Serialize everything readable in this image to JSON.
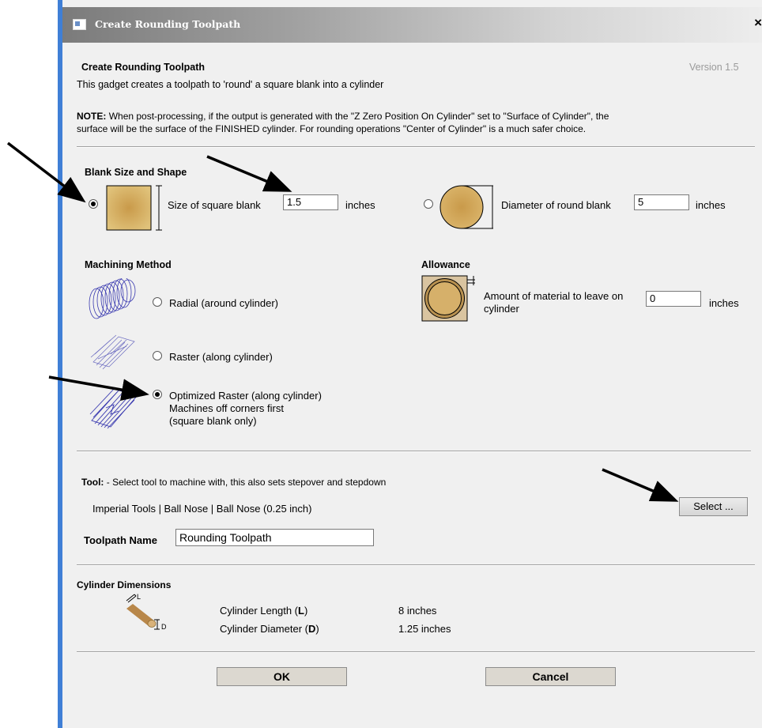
{
  "window": {
    "title": "Create Rounding Toolpath",
    "close_glyph": "×"
  },
  "header": {
    "title": "Create Rounding Toolpath",
    "version": "Version 1.5",
    "description": "This gadget creates a toolpath to 'round' a square blank into a cylinder",
    "note_label": "NOTE:",
    "note_line1": "When post-processing, if the output is generated with the \"Z Zero Position On Cylinder\" set to \"Surface of Cylinder\", the",
    "note_line2": "surface will be the surface of the FINISHED cylinder. For rounding operations \"Center of Cylinder\" is a much safer choice."
  },
  "blank": {
    "section_title": "Blank Size and Shape",
    "square": {
      "label": "Size of square blank",
      "value": "1.5",
      "unit": "inches",
      "selected": true
    },
    "round": {
      "label": "Diameter of round blank",
      "value": "5",
      "unit": "inches",
      "selected": false
    }
  },
  "machining": {
    "section_title": "Machining Method",
    "radial": {
      "label": "Radial (around cylinder)",
      "selected": false
    },
    "raster": {
      "label": "Raster (along cylinder)",
      "selected": false
    },
    "optimized": {
      "label": "Optimized Raster (along cylinder)",
      "line2": "Machines off corners first",
      "line3": "(square blank only)",
      "selected": true
    }
  },
  "allowance": {
    "section_title": "Allowance",
    "label_line1": "Amount of material to leave on",
    "label_line2": "cylinder",
    "value": "0",
    "unit": "inches"
  },
  "tool": {
    "label": "Tool:",
    "description": " - Select tool to machine with, this also sets stepover and stepdown",
    "current": "Imperial Tools | Ball Nose | Ball Nose (0.25 inch)",
    "select_button": "Select ...",
    "toolpath_name_label": "Toolpath Name",
    "toolpath_name_value": "Rounding Toolpath"
  },
  "cylinder": {
    "section_title": "Cylinder Dimensions",
    "length_label_prefix": "Cylinder Length (",
    "length_key": "L",
    "length_label_suffix": ")",
    "length_value": "8  inches",
    "diameter_label_prefix": "Cylinder Diameter (",
    "diameter_key": "D",
    "diameter_label_suffix": ")",
    "diameter_value": "1.25  inches",
    "icon_l": "L",
    "icon_d": "D"
  },
  "buttons": {
    "ok": "OK",
    "cancel": "Cancel"
  },
  "colors": {
    "wood": "#c8a15a",
    "wood_dark": "#8a6a2f",
    "wireframe": "#3a3ab0",
    "title_gradient_start": "#7b7b7b",
    "left_strip": "#3f7fd6"
  }
}
